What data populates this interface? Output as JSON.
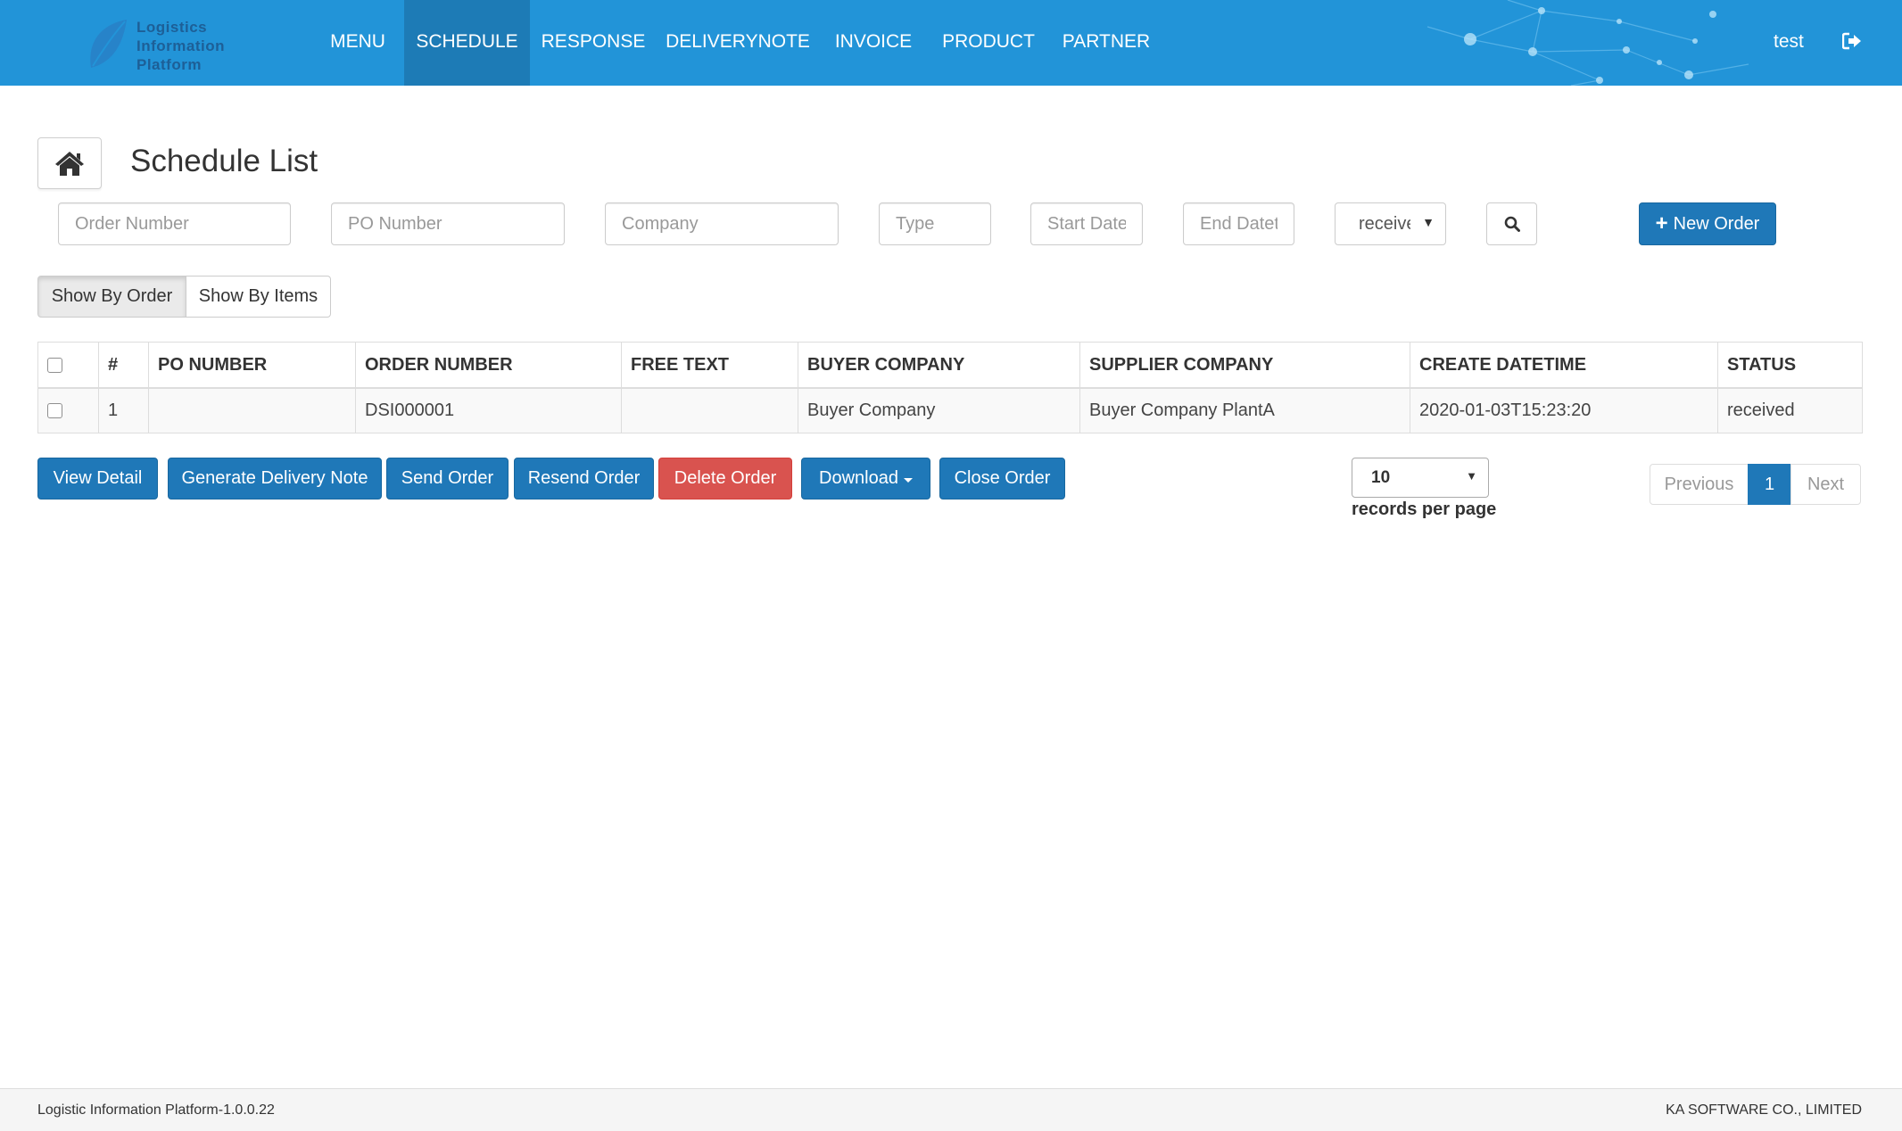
{
  "app": {
    "logo_lines": [
      "Logistics",
      "Information",
      "Platform"
    ],
    "user": "test"
  },
  "nav": {
    "items": [
      "MENU",
      "SCHEDULE",
      "RESPONSE",
      "DELIVERYNOTE",
      "INVOICE",
      "PRODUCT",
      "PARTNER"
    ],
    "active": "SCHEDULE"
  },
  "page": {
    "title": "Schedule List"
  },
  "filters": {
    "order_number_placeholder": "Order Number",
    "po_number_placeholder": "PO Number",
    "company_placeholder": "Company",
    "type_placeholder": "Type",
    "start_date_placeholder": "Start Date",
    "end_date_placeholder": "End Datet",
    "status_value": "received",
    "new_order_label": "New Order"
  },
  "view_toggle": {
    "by_order": "Show By Order",
    "by_items": "Show By Items",
    "selected": "Show By Order"
  },
  "table": {
    "headers": [
      "#",
      "PO NUMBER",
      "ORDER NUMBER",
      "FREE TEXT",
      "BUYER COMPANY",
      "SUPPLIER COMPANY",
      "CREATE DATETIME",
      "STATUS"
    ],
    "rows": [
      {
        "num": "1",
        "po_number": "",
        "order_number": "DSI000001",
        "free_text": "",
        "buyer_company": "Buyer Company",
        "supplier_company": "Buyer Company PlantA",
        "create_datetime": "2020-01-03T15:23:20",
        "status": "received"
      }
    ]
  },
  "actions": {
    "view_detail": "View Detail",
    "generate_delivery_note": "Generate Delivery Note",
    "send_order": "Send Order",
    "resend_order": "Resend Order",
    "delete_order": "Delete Order",
    "download": "Download",
    "close_order": "Close Order"
  },
  "pagination": {
    "per_page_value": "10",
    "per_page_label": "records per page",
    "previous": "Previous",
    "current_page": "1",
    "next": "Next"
  },
  "footer": {
    "left": "Logistic Information Platform-1.0.0.22",
    "right": "KA SOFTWARE CO., LIMITED"
  },
  "colors": {
    "navbar": "#2294d8",
    "nav_active": "#1d7bb6",
    "primary_button": "#1f78b8",
    "danger_button": "#d9534f"
  }
}
